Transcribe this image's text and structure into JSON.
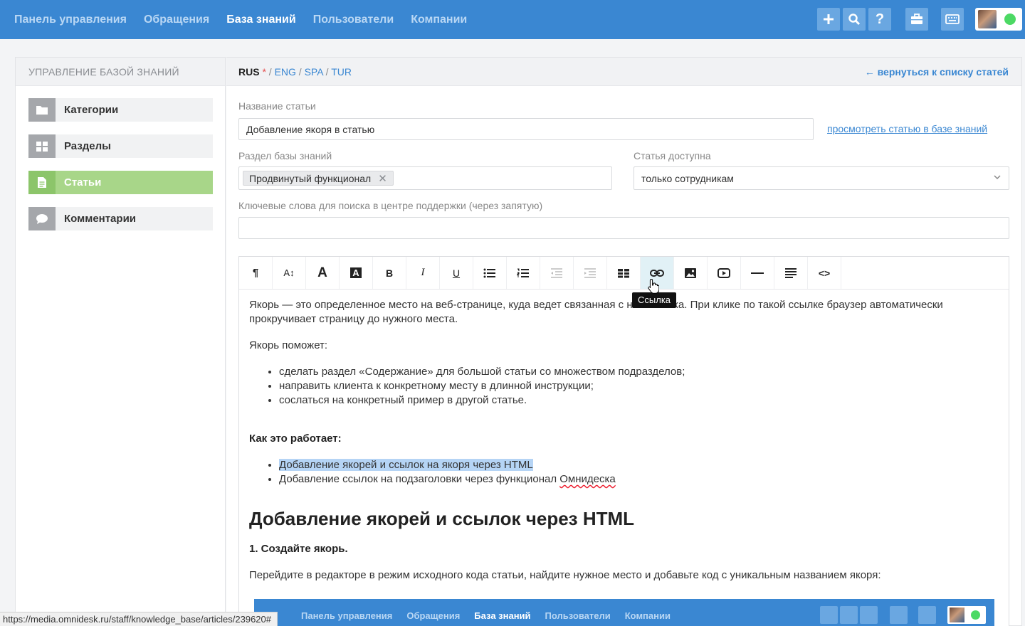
{
  "nav": {
    "items": [
      "Панель управления",
      "Обращения",
      "База знаний",
      "Пользователи",
      "Компании"
    ],
    "active_index": 2
  },
  "topbar_icons": [
    "plus-icon",
    "search-icon",
    "help-icon",
    "briefcase-icon",
    "keyboard-icon"
  ],
  "sidebar": {
    "header": "УПРАВЛЕНИЕ БАЗОЙ ЗНАНИЙ",
    "items": [
      {
        "label": "Категории",
        "icon": "folder-icon"
      },
      {
        "label": "Разделы",
        "icon": "grid-icon"
      },
      {
        "label": "Статьи",
        "icon": "document-icon",
        "active": true
      },
      {
        "label": "Комментарии",
        "icon": "comment-icon"
      }
    ]
  },
  "lang": {
    "current": "RUS",
    "required_mark": "*",
    "others": [
      "ENG",
      "SPA",
      "TUR"
    ],
    "sep": " / ",
    "back_link": "← вернуться к списку статей"
  },
  "form": {
    "title_label": "Название статьи",
    "title_value": "Добавление якоря в статью",
    "view_link": "просмотреть статью в базе знаний",
    "section_label": "Раздел базы знаний",
    "section_tag": "Продвинутый функционал",
    "access_label": "Статья доступна",
    "access_value": "только сотрудникам",
    "keywords_label": "Ключевые слова для поиска в центре поддержки (через запятую)",
    "keywords_value": ""
  },
  "toolbar": {
    "buttons": [
      "paragraph-icon",
      "font-size-icon",
      "text-color-icon",
      "background-color-icon",
      "bold-icon",
      "italic-icon",
      "underline-icon",
      "unordered-list-icon",
      "ordered-list-icon",
      "outdent-icon",
      "indent-icon",
      "table-icon",
      "link-icon",
      "image-icon",
      "video-icon",
      "horizontal-rule-icon",
      "align-icon",
      "source-code-icon"
    ],
    "hover_index": 12,
    "tooltip": "Ссылка"
  },
  "article": {
    "p1": "Якорь — это определенное место на веб-странице, куда ведет связанная с ним ссылка. При клике по такой ссылке браузер автоматически прокручивает страницу до нужного места.",
    "p2": "Якорь поможет:",
    "list1": [
      "сделать раздел «Содержание» для большой статьи со множеством подразделов;",
      "направить клиента к конкретному месту в длинной инструкции;",
      "сослаться на конкретный пример в другой статье."
    ],
    "h_how": "Как это работает:",
    "list2_item1": "Добавление якорей и ссылок на якоря через HTML",
    "list2_item2_prefix": "Добавление ссылок на подзаголовки через функционал ",
    "list2_item2_word": "Омнидеска",
    "h2": "Добавление якорей и ссылок через HTML",
    "step1": "1. Создайте якорь.",
    "p3": "Перейдите в редакторе в режим исходного кода статьи, найдите нужное место и добавьте код с уникальным названием якоря:"
  },
  "embed": {
    "nav": [
      "Панель управления",
      "Обращения",
      "База знаний",
      "Пользователи",
      "Компании"
    ],
    "active_index": 2
  },
  "status_url": "https://media.omnidesk.ru/staff/knowledge_base/articles/239620#",
  "colors": {
    "brand": "#3a87d2",
    "active_green": "#a8d689",
    "online": "#4cd964"
  }
}
